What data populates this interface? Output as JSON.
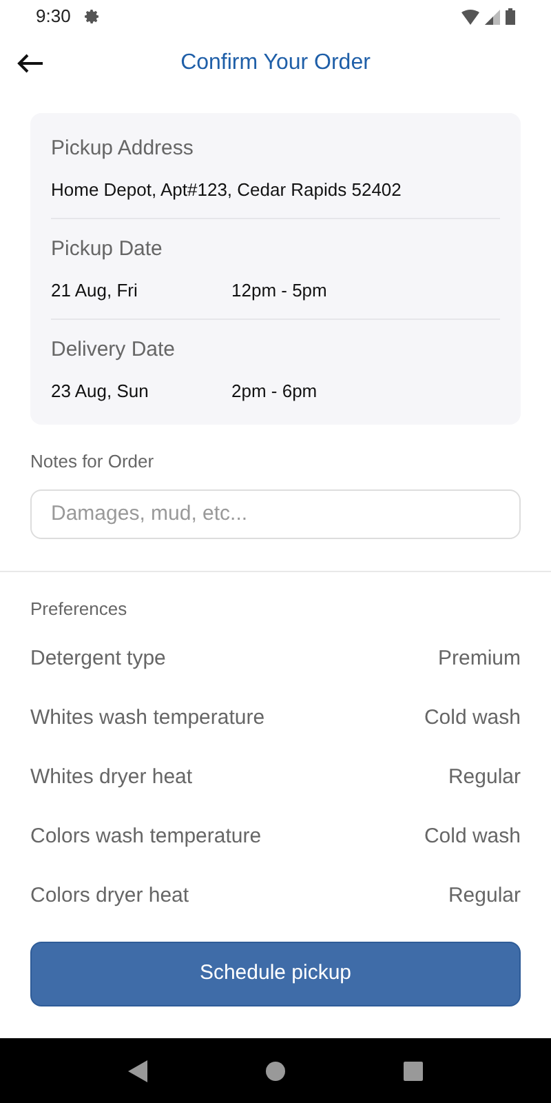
{
  "status_bar": {
    "time": "9:30"
  },
  "header": {
    "title": "Confirm Your Order"
  },
  "summary": [
    {
      "kind": "single",
      "label": "Pickup Address",
      "value": "Home Depot, Apt#123, Cedar Rapids 52402"
    },
    {
      "kind": "pair",
      "label": "Pickup Date",
      "value": "21 Aug, Fri",
      "time": "12pm - 5pm"
    },
    {
      "kind": "pair",
      "label": "Delivery Date",
      "value": "23 Aug, Sun",
      "time": "2pm - 6pm"
    }
  ],
  "notes": {
    "label": "Notes for Order",
    "placeholder": "Damages, mud, etc..."
  },
  "preferences": {
    "title": "Preferences",
    "rows": [
      {
        "label": "Detergent type",
        "value": "Premium"
      },
      {
        "label": "Whites wash temperature",
        "value": "Cold wash"
      },
      {
        "label": "Whites dryer heat",
        "value": "Regular"
      },
      {
        "label": "Colors wash temperature",
        "value": "Cold wash"
      },
      {
        "label": "Colors dryer heat",
        "value": "Regular"
      }
    ]
  },
  "button": {
    "label": "Schedule pickup"
  }
}
